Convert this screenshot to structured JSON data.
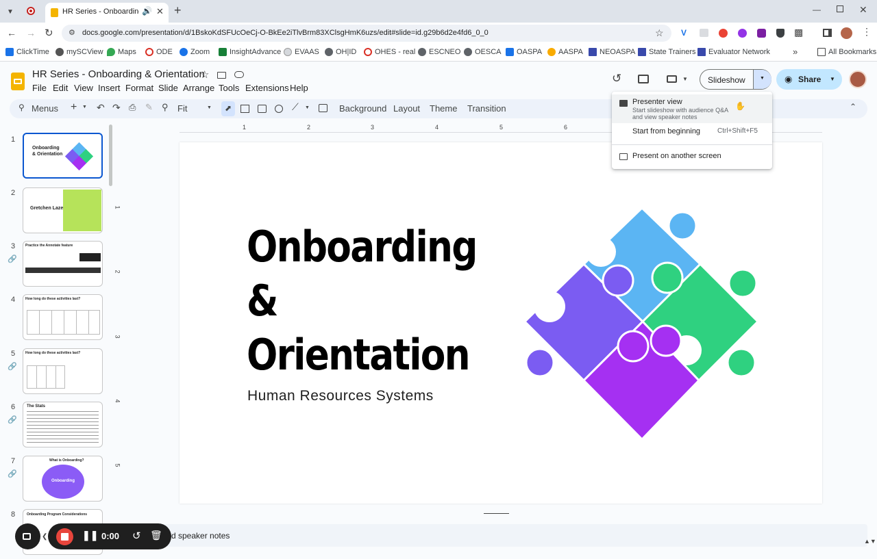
{
  "browser": {
    "tab_title": "HR Series - Onboarding & Orientation",
    "new_tab": "+",
    "url": "docs.google.com/presentation/d/1BskoKdSFUcOeCj-O-BkEe2iTlvBrm83XClsgHmK6uzs/edit#slide=id.g29b6d2e4fd6_0_0"
  },
  "bookmarks": [
    "ClickTime",
    "mySCView",
    "Maps",
    "ODE",
    "Zoom",
    "InsightAdvance",
    "EVAAS",
    "OH|ID",
    "OHES - real",
    "ESCNEO",
    "OESCA",
    "OASPA",
    "AASPA",
    "NEOASPA",
    "State Trainers",
    "Evaluator Network"
  ],
  "all_bookmarks": "All Bookmarks",
  "doc": {
    "title": "HR Series - Onboarding & Orientation",
    "menus": [
      "File",
      "Edit",
      "View",
      "Insert",
      "Format",
      "Slide",
      "Arrange",
      "Tools",
      "Extensions",
      "Help"
    ],
    "slideshow": "Slideshow",
    "share": "Share"
  },
  "toolbar": {
    "search": "Menus",
    "zoom": "Fit",
    "background": "Background",
    "layout": "Layout",
    "theme": "Theme",
    "transition": "Transition"
  },
  "ruler": [
    "1",
    "2",
    "3",
    "4",
    "5",
    "6"
  ],
  "vruler": [
    "1",
    "2",
    "3",
    "4",
    "5"
  ],
  "dropdown": {
    "presenter_view": "Presenter view",
    "presenter_desc_1": "Start slideshow with audience Q&A",
    "presenter_desc_2": "and view speaker notes",
    "start_beginning": "Start from beginning",
    "shortcut": "Ctrl+Shift+F5",
    "another_screen": "Present on another screen"
  },
  "slide": {
    "title_1": "Onboarding",
    "title_2": "&",
    "title_3": "Orientation",
    "subtitle": "Human Resources Systems",
    "colors": {
      "blue": "#5bb5f3",
      "purple_light": "#7b5cf2",
      "green": "#2fd180",
      "purple": "#a530f2"
    }
  },
  "thumbnails": [
    {
      "num": "1",
      "title": "Onboarding & Orientation"
    },
    {
      "num": "2",
      "title": "Gretchen Lazen"
    },
    {
      "num": "3",
      "title": "Practice the Annotate feature"
    },
    {
      "num": "4",
      "title": "How long do these activities last?"
    },
    {
      "num": "5",
      "title": "How long do these activities last?"
    },
    {
      "num": "6",
      "title": "The Stats"
    },
    {
      "num": "7",
      "title": "What is Onboarding?",
      "center": "Onboarding"
    },
    {
      "num": "8",
      "title": "Onboarding Program Considerations"
    }
  ],
  "notes": {
    "placeholder": "d speaker notes"
  },
  "recorder": {
    "time": "0:00"
  }
}
